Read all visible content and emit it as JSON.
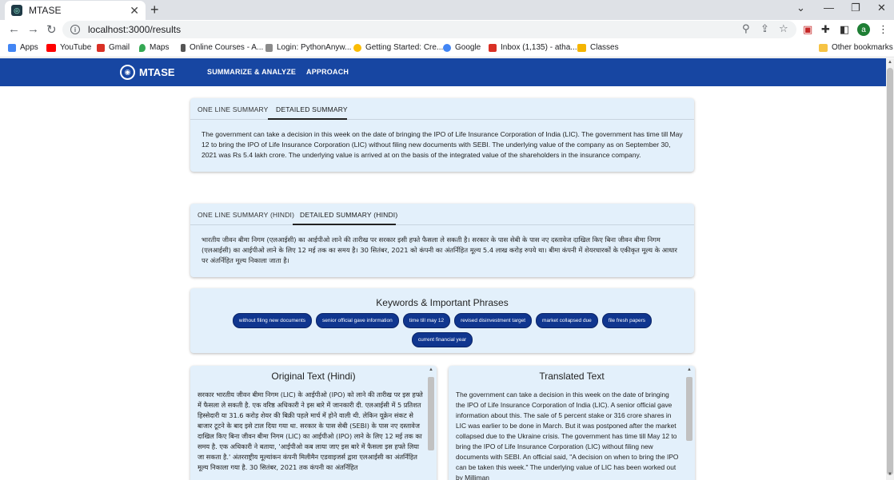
{
  "browser": {
    "tab_title": "MTASE",
    "url": "localhost:3000/results",
    "bookmarks": [
      {
        "label": "Apps"
      },
      {
        "label": "YouTube"
      },
      {
        "label": "Gmail"
      },
      {
        "label": "Maps"
      },
      {
        "label": "Online Courses - A..."
      },
      {
        "label": "Login: PythonAnyw..."
      },
      {
        "label": "Getting Started: Cre..."
      },
      {
        "label": "Google"
      },
      {
        "label": "Inbox (1,135) - atha..."
      },
      {
        "label": "Classes"
      }
    ],
    "other_bookmarks": "Other bookmarks",
    "profile_initial": "a"
  },
  "app": {
    "brand": "MTASE",
    "nav": [
      "SUMMARIZE & ANALYZE",
      "APPROACH"
    ],
    "summary_card": {
      "tabs": [
        "ONE LINE SUMMARY",
        "DETAILED SUMMARY"
      ],
      "active_tab": "DETAILED SUMMARY",
      "text": "The government can take a decision in this week on the date of bringing the IPO of Life Insurance Corporation of India (LIC). The government has time till May 12 to bring the IPO of Life Insurance Corporation (LIC) without filing new documents with SEBI. The underlying value of the company as on September 30, 2021 was Rs 5.4 lakh crore. The underlying value is arrived at on the basis of the integrated value of the shareholders in the insurance company."
    },
    "hindi_card": {
      "tabs": [
        "ONE LINE SUMMARY (HINDI)",
        "DETAILED SUMMARY (HINDI)"
      ],
      "active_tab": "DETAILED SUMMARY (HINDI)",
      "text": "भारतीय जीवन बीमा निगम (एलआईसी) का आईपीओ लाने की तारीख पर सरकार इसी हफ्ते फैसला ले सकती है। सरकार के पास सेबी के पास नए दस्तावेज दाखिल किए बिना जीवन बीमा निगम (एलआईसी) का आईपीओ लाने के लिए 12 मई तक का समय है। 30 सितंबर, 2021 को कंपनी का अंतर्निहित मूल्य 5.4 लाख करोड़ रुपये था। बीमा कंपनी में शेयरधारकों के एकीकृत मूल्य के आधार पर अंतर्निहित मूल्य निकाला जाता है।"
    },
    "keywords": {
      "title": "Keywords & Important Phrases",
      "items": [
        "without filing new documents",
        "senior official gave information",
        "time till may 12",
        "revised disinvestment target",
        "market collapsed due",
        "file fresh papers",
        "current financial year"
      ]
    },
    "original": {
      "title": "Original Text (Hindi)",
      "text": "सरकार भारतीय जीवन बीमा निगम (LIC) के आईपीओ (IPO) को लाने की तारीख पर इस हफ्ते में फैसला ले सकती है. एक वरिष्ठ अधिकारी ने इस बारे में जानकारी दी. एलआईसी में 5 प्रतिशत हिस्सेदारी या 31.6 करोड़ शेयर की बिक्री पहले मार्च में होने वाली थी. लेकिन यूक्रेन संकट से बाजार टूटने के बाद इसे टाल दिया गया था. सरकार के पास सेबी (SEBI) के पास नए दस्तावेज दाखिल किए बिना जीवन बीमा निगम (LIC) का आईपीओ (IPO) लाने के लिए 12 मई तक का समय है. एक अधिकारी ने बताया, 'आईपीओ कब लाया जाए इस बारे में फैसला इस हफ्ते लिया जा सकता है.' अंतरराष्ट्रीय मूल्यांकन कंपनी मिलीमैन एडवाइजर्स द्वारा एलआईसी का अंतर्निहित मूल्य निकाला गया है. 30 सितंबर, 2021 तक कंपनी का अंतर्निहित"
    },
    "translated": {
      "title": "Translated Text",
      "text": "The government can take a decision in this week on the date of bringing the IPO of Life Insurance Corporation of India (LIC). A senior official gave information about this. The sale of 5 percent stake or 316 crore shares in LIC was earlier to be done in March. But it was postponed after the market collapsed due to the Ukraine crisis. The government has time till May 12 to bring the IPO of Life Insurance Corporation (LIC) without filing new documents with SEBI. An official said, \"A decision on when to bring the IPO can be taken this week.\" The underlying value of LIC has been worked out by Milliman"
    }
  },
  "colors": {
    "appbar": "#1746a2",
    "card_bg": "#e3f0fb",
    "chip_bg": "#10368f"
  }
}
